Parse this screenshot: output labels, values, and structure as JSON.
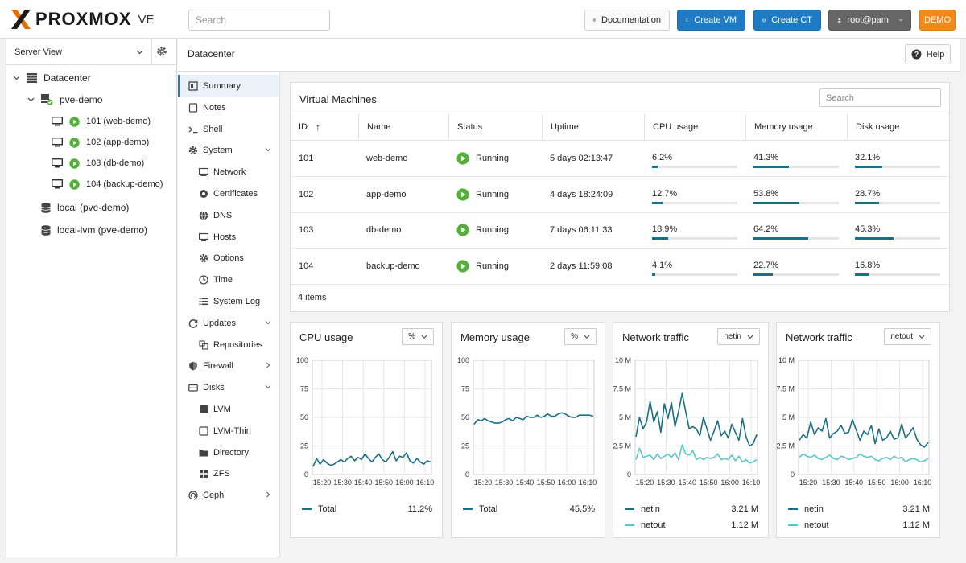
{
  "header": {
    "logo_text": "PROXMOX",
    "logo_ve": "VE",
    "search_placeholder": "Search",
    "documentation_label": "Documentation",
    "create_vm_label": "Create VM",
    "create_ct_label": "Create CT",
    "user_label": "root@pam",
    "demo_label": "DEMO"
  },
  "tree": {
    "view_label": "Server View",
    "datacenter_label": "Datacenter",
    "node_label": "pve-demo",
    "vms": [
      "101 (web-demo)",
      "102 (app-demo)",
      "103 (db-demo)",
      "104 (backup-demo)"
    ],
    "storages": [
      "local (pve-demo)",
      "local-lvm (pve-demo)"
    ]
  },
  "panel": {
    "title": "Datacenter",
    "help_label": "Help"
  },
  "menu": [
    {
      "label": "Summary",
      "icon": "summary-icon",
      "active": true
    },
    {
      "label": "Notes",
      "icon": "notes-icon"
    },
    {
      "label": "Shell",
      "icon": "shell-icon"
    },
    {
      "label": "System",
      "icon": "gear-icon",
      "expandable": true,
      "expanded": true
    },
    {
      "label": "Network",
      "icon": "network-icon",
      "sub": true
    },
    {
      "label": "Certificates",
      "icon": "certificate-icon",
      "sub": true
    },
    {
      "label": "DNS",
      "icon": "globe-icon",
      "sub": true
    },
    {
      "label": "Hosts",
      "icon": "hosts-icon",
      "sub": true
    },
    {
      "label": "Options",
      "icon": "gear-icon",
      "sub": true
    },
    {
      "label": "Time",
      "icon": "clock-icon",
      "sub": true
    },
    {
      "label": "System Log",
      "icon": "list-icon",
      "sub": true
    },
    {
      "label": "Updates",
      "icon": "refresh-icon",
      "expandable": true,
      "expanded": true
    },
    {
      "label": "Repositories",
      "icon": "package-icon",
      "sub": true
    },
    {
      "label": "Firewall",
      "icon": "shield-icon",
      "expandable": true,
      "expanded": false
    },
    {
      "label": "Disks",
      "icon": "disk-icon",
      "expandable": true,
      "expanded": true
    },
    {
      "label": "LVM",
      "icon": "lvm-icon",
      "sub": true
    },
    {
      "label": "LVM-Thin",
      "icon": "lvm-thin-icon",
      "sub": true
    },
    {
      "label": "Directory",
      "icon": "folder-icon",
      "sub": true
    },
    {
      "label": "ZFS",
      "icon": "zfs-icon",
      "sub": true
    },
    {
      "label": "Ceph",
      "icon": "ceph-icon",
      "expandable": true,
      "expanded": false
    }
  ],
  "vm_table": {
    "title": "Virtual Machines",
    "search_placeholder": "Search",
    "sort_indicator": "↑",
    "columns": [
      "ID",
      "Name",
      "Status",
      "Uptime",
      "CPU usage",
      "Memory usage",
      "Disk usage"
    ],
    "rows": [
      {
        "id": "101",
        "name": "web-demo",
        "status": "Running",
        "uptime": "5 days 02:13:47",
        "cpu": "6.2%",
        "cpu_v": 6.2,
        "mem": "41.3%",
        "mem_v": 41.3,
        "disk": "32.1%",
        "disk_v": 32.1
      },
      {
        "id": "102",
        "name": "app-demo",
        "status": "Running",
        "uptime": "4 days 18:24:09",
        "cpu": "12.7%",
        "cpu_v": 12.7,
        "mem": "53.8%",
        "mem_v": 53.8,
        "disk": "28.7%",
        "disk_v": 28.7
      },
      {
        "id": "103",
        "name": "db-demo",
        "status": "Running",
        "uptime": "7 days 06:11:33",
        "cpu": "18.9%",
        "cpu_v": 18.9,
        "mem": "64.2%",
        "mem_v": 64.2,
        "disk": "45.3%",
        "disk_v": 45.3
      },
      {
        "id": "104",
        "name": "backup-demo",
        "status": "Running",
        "uptime": "2 days 11:59:08",
        "cpu": "4.1%",
        "cpu_v": 4.1,
        "mem": "22.7%",
        "mem_v": 22.7,
        "disk": "16.8%",
        "disk_v": 16.8
      }
    ],
    "footer": "4 items"
  },
  "colors": {
    "accent": "#1f7cc4",
    "series_dark": "#1d6f86",
    "series_light": "#59c6cc",
    "running": "#55b03b",
    "demo": "#f18a1c"
  },
  "charts": [
    {
      "title": "CPU usage",
      "unit_select": "%",
      "legend": [
        {
          "name": "Total",
          "value": "11.2%"
        }
      ]
    },
    {
      "title": "Memory usage",
      "unit_select": "%",
      "legend": [
        {
          "name": "Total",
          "value": "45.5%"
        }
      ]
    },
    {
      "title": "Network traffic",
      "unit_select": "netin",
      "legend": [
        {
          "name": "netin",
          "value": "3.21 M"
        },
        {
          "name": "netout",
          "value": "1.12 M"
        }
      ]
    },
    {
      "title": "Network traffic",
      "unit_select": "netout",
      "legend": [
        {
          "name": "netin",
          "value": "3.21 M"
        },
        {
          "name": "netout",
          "value": "1.12 M"
        }
      ]
    }
  ],
  "chart_data": [
    {
      "type": "line",
      "title": "CPU usage",
      "x_ticks": [
        "15:20",
        "15:30",
        "15:40",
        "15:50",
        "16:00",
        "16:10"
      ],
      "y_ticks": [
        "0",
        "25",
        "50",
        "75",
        "100"
      ],
      "ylim": [
        0,
        100
      ],
      "series": [
        {
          "name": "Total",
          "values": [
            7,
            14,
            9,
            13,
            10,
            8,
            9,
            11,
            13,
            11,
            14,
            16,
            12,
            15,
            13,
            18,
            14,
            11,
            15,
            18,
            13,
            11,
            15,
            20,
            12,
            16,
            15,
            19,
            12,
            10,
            14,
            11,
            9,
            12,
            11
          ]
        }
      ]
    },
    {
      "type": "line",
      "title": "Memory usage",
      "x_ticks": [
        "15:20",
        "15:30",
        "15:40",
        "15:50",
        "16:00",
        "16:10"
      ],
      "y_ticks": [
        "0",
        "25",
        "50",
        "75",
        "100"
      ],
      "ylim": [
        0,
        100
      ],
      "series": [
        {
          "name": "Total",
          "values": [
            44,
            48,
            47,
            49,
            47,
            46,
            45,
            45,
            46,
            48,
            49,
            47,
            50,
            49,
            48,
            51,
            50,
            50,
            52,
            50,
            51,
            53,
            51,
            51,
            53,
            54,
            53,
            51,
            50,
            50,
            52,
            52,
            52,
            52,
            51
          ]
        }
      ]
    },
    {
      "type": "line",
      "title": "Network traffic",
      "x_ticks": [
        "15:20",
        "15:30",
        "15:40",
        "15:50",
        "16:00",
        "16:10"
      ],
      "y_ticks": [
        "0",
        "2.5 M",
        "5 M",
        "7.5 M",
        "10 M"
      ],
      "ylim": [
        0,
        10
      ],
      "series": [
        {
          "name": "netin",
          "values": [
            3.3,
            5.0,
            4.0,
            4.6,
            6.4,
            4.6,
            5.5,
            3.7,
            6.2,
            4.9,
            6.3,
            4.2,
            5.5,
            7.1,
            5.5,
            4.0,
            4.2,
            4.0,
            3.4,
            5.0,
            4.0,
            3.0,
            3.8,
            4.7,
            3.4,
            3.8,
            3.2,
            4.4,
            3.7,
            3.0,
            4.9,
            3.3,
            2.5,
            2.7,
            3.5
          ]
        },
        {
          "name": "netout",
          "values": [
            1.3,
            2.3,
            1.5,
            1.6,
            1.7,
            1.3,
            1.8,
            1.4,
            1.6,
            1.8,
            1.5,
            1.9,
            1.3,
            2.6,
            1.8,
            1.7,
            2.1,
            1.3,
            1.5,
            1.3,
            1.5,
            1.4,
            1.5,
            1.8,
            1.3,
            1.4,
            1.3,
            1.7,
            1.2,
            1.6,
            1.1,
            1.3,
            1.0,
            1.1,
            1.3
          ]
        }
      ]
    },
    {
      "type": "line",
      "title": "Network traffic",
      "x_ticks": [
        "15:20",
        "15:30",
        "15:40",
        "15:50",
        "16:00",
        "16:10"
      ],
      "y_ticks": [
        "0",
        "2.5 M",
        "5 M",
        "7.5 M",
        "10 M"
      ],
      "ylim": [
        0,
        10
      ],
      "series": [
        {
          "name": "netin",
          "values": [
            3.0,
            3.5,
            3.2,
            4.6,
            3.5,
            4.1,
            3.8,
            4.9,
            3.2,
            3.6,
            3.8,
            4.3,
            3.6,
            3.7,
            4.8,
            3.9,
            3.0,
            3.8,
            3.5,
            4.3,
            2.7,
            4.0,
            3.0,
            3.2,
            3.8,
            3.1,
            3.2,
            4.4,
            3.2,
            3.6,
            4.1,
            3.1,
            2.6,
            2.4,
            2.8
          ]
        },
        {
          "name": "netout",
          "values": [
            1.5,
            1.8,
            1.6,
            1.5,
            1.7,
            1.4,
            1.3,
            1.5,
            1.7,
            1.4,
            1.3,
            1.6,
            1.5,
            1.3,
            1.4,
            1.5,
            1.8,
            1.6,
            1.5,
            1.6,
            1.3,
            1.2,
            1.4,
            1.5,
            1.3,
            1.6,
            1.4,
            1.5,
            1.1,
            1.3,
            1.4,
            1.3,
            1.1,
            1.2,
            1.4
          ]
        }
      ]
    }
  ]
}
